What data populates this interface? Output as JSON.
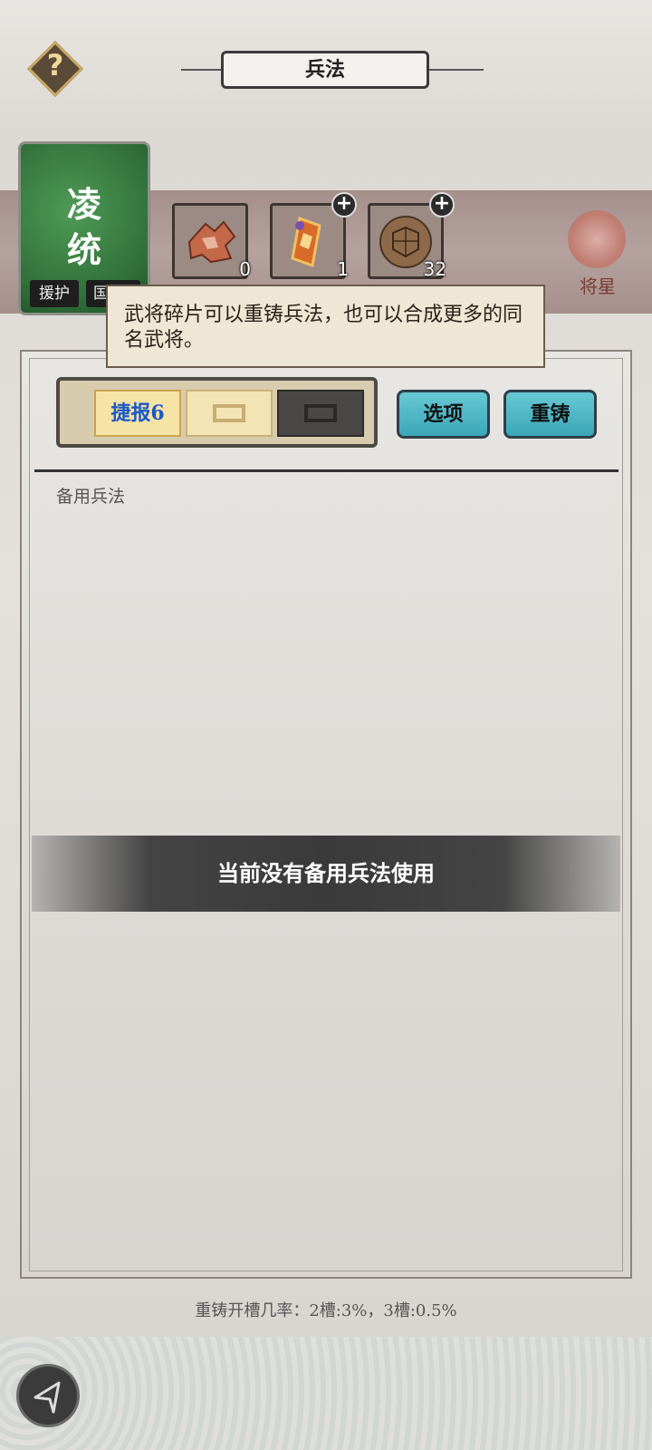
{
  "header": {
    "title": "兵法",
    "help_glyph": "?"
  },
  "general": {
    "name_line1": "凌",
    "name_line2": "统",
    "tags": [
      "援护",
      "国"
    ]
  },
  "items": [
    {
      "icon": "puzzle-fragment-icon",
      "count": "0",
      "has_plus": false
    },
    {
      "icon": "scroll-token-icon",
      "count": "1",
      "has_plus": true
    },
    {
      "icon": "turtle-shell-icon",
      "count": "32",
      "has_plus": true
    }
  ],
  "jiangxing": {
    "label": "将星",
    "icon": "jiangxing-emblem-icon"
  },
  "tooltip": {
    "text": "武将碎片可以重铸兵法，也可以合成更多的同名武将。"
  },
  "slots": {
    "slot1_label": "捷报6"
  },
  "buttons": {
    "options": "选项",
    "recast": "重铸"
  },
  "section": {
    "label": "备用兵法"
  },
  "empty_message": "当前没有备用兵法使用",
  "footer": {
    "rate_text": "重铸开槽几率：2槽:3%，3槽:0.5%"
  },
  "colors": {
    "accent_teal": "#4cb6c5",
    "maroon_band": "#a8928e",
    "card_green": "#3d8347"
  }
}
